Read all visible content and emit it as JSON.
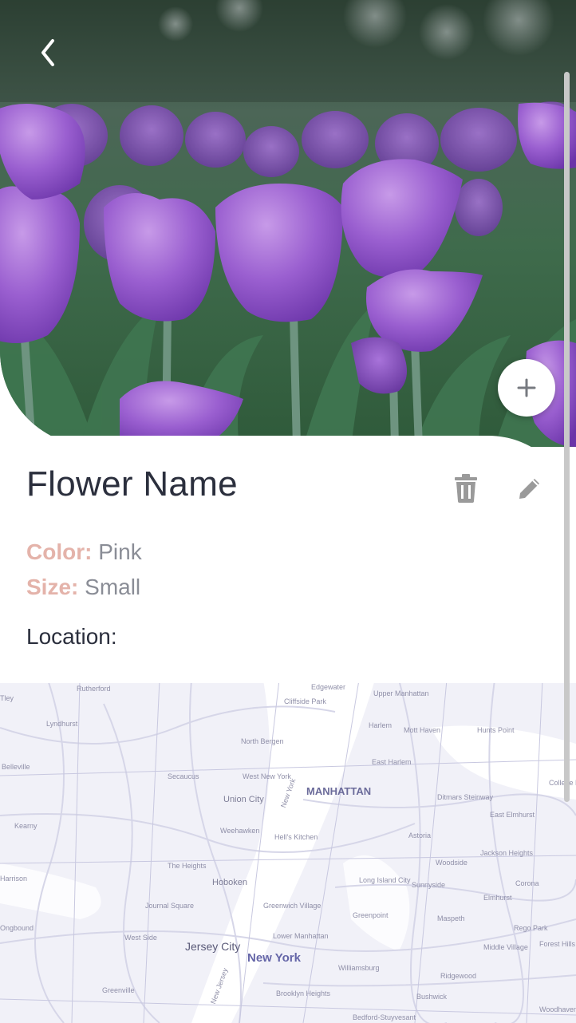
{
  "flower": {
    "name": "Flower Name",
    "color_label": "Color:",
    "color_value": "Pink",
    "size_label": "Size:",
    "size_value": "Small",
    "location_label": "Location:"
  },
  "icons": {
    "back": "chevron-left-icon",
    "add": "plus-icon",
    "delete": "trash-icon",
    "edit": "pencil-icon"
  },
  "colors": {
    "title": "#2b2f3d",
    "attribute_label": "#e4b3aa",
    "attribute_value": "#8a8d96",
    "map_background": "#f1f1f8"
  },
  "map": {
    "labels": [
      "Rutherford",
      "Edgewater",
      "Upper Manhattan",
      "Cliffside Park",
      "Harlem",
      "Mott Haven",
      "Hunts Point",
      "Lyndhurst",
      "North Bergen",
      "East Harlem",
      "Belleville",
      "Secaucus",
      "West New York",
      "Union City",
      "MANHATTAN",
      "Ditmars Steinway",
      "Kearny",
      "Weehawken",
      "Hell's Kitchen",
      "Astoria",
      "East Elmhurst",
      "Jackson Heights",
      "Woodside",
      "The Heights",
      "Hoboken",
      "Long Island City",
      "Sunnyside",
      "Corona",
      "Elmhurst",
      "Harrison",
      "Journal Square",
      "Greenwich Village",
      "Greenpoint",
      "Maspeth",
      "Rego Park",
      "West Side",
      "Lower Manhattan",
      "Jersey City",
      "New York",
      "Williamsburg",
      "Middle Village",
      "Forest Hills",
      "Greenville",
      "Brooklyn Heights",
      "Ridgewood",
      "Bushwick",
      "Woodhaven",
      "Bedford-Stuyvesant",
      "New Jersey",
      "New York",
      "College Point",
      "Tley",
      "Ongbound"
    ]
  }
}
